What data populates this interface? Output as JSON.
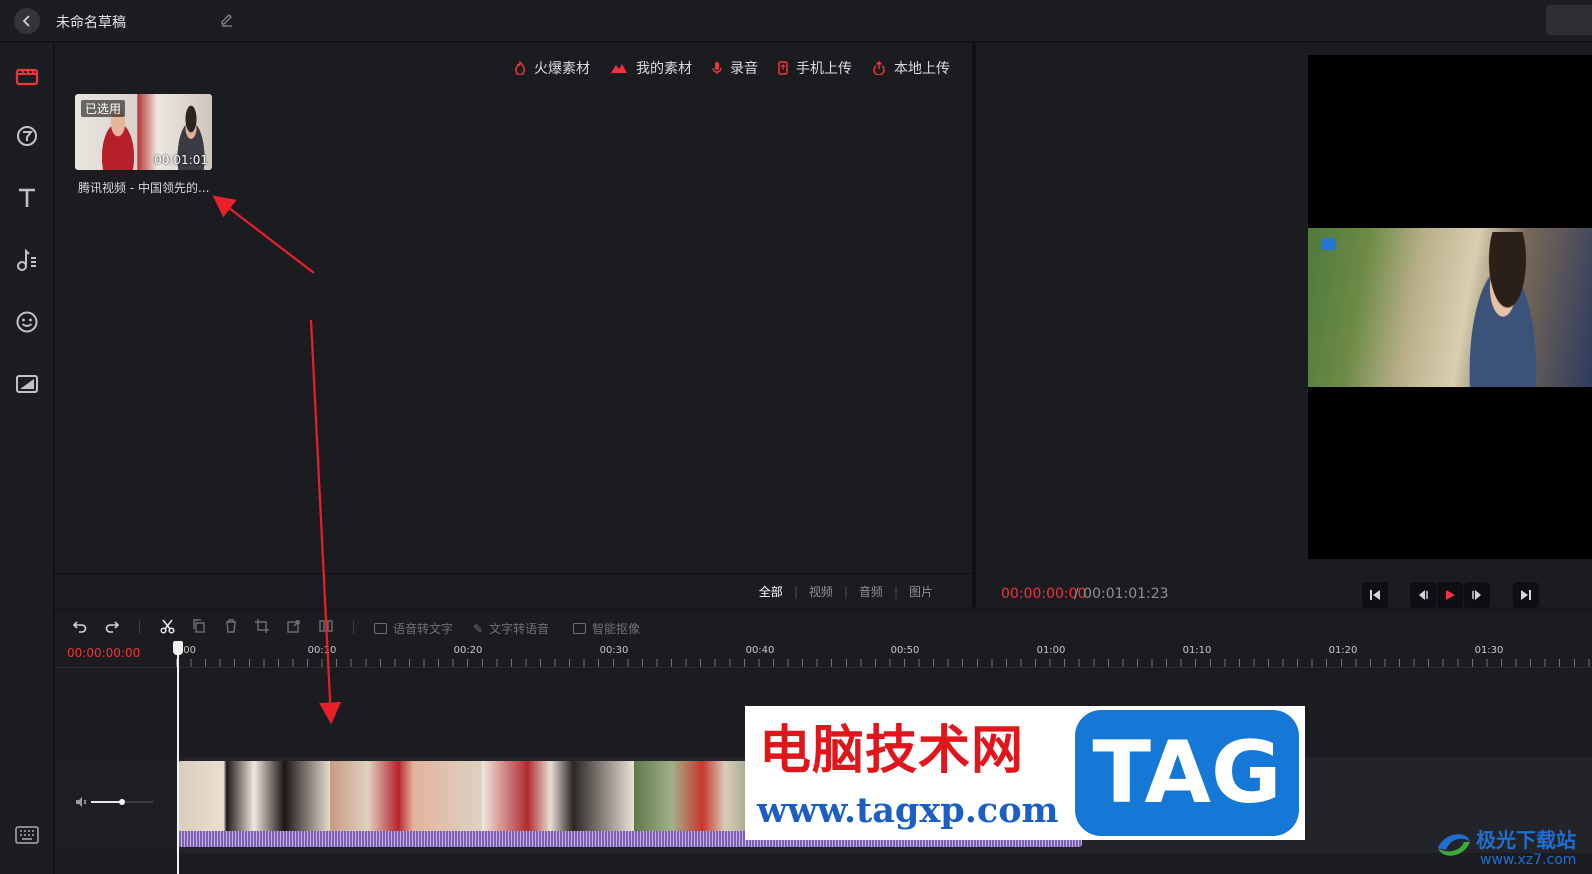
{
  "header": {
    "title": "未命名草稿",
    "back_icon": "chevron-left-icon",
    "edit_icon": "pencil-icon"
  },
  "sidebar": {
    "items": [
      {
        "icon": "film-icon",
        "active": true
      },
      {
        "icon": "filter-icon"
      },
      {
        "icon": "text-icon"
      },
      {
        "icon": "music-icon"
      },
      {
        "icon": "sticker-icon"
      },
      {
        "icon": "picture-icon"
      }
    ],
    "bottom_icon": "keyboard-icon"
  },
  "media": {
    "source_tabs": [
      {
        "label": "火爆素材",
        "icon": "flame-icon"
      },
      {
        "label": "我的素材",
        "icon": "mountain-icon"
      },
      {
        "label": "录音",
        "icon": "mic-icon"
      },
      {
        "label": "手机上传",
        "icon": "phone-icon"
      },
      {
        "label": "本地上传",
        "icon": "upload-icon"
      }
    ],
    "item": {
      "badge": "已选用",
      "duration": "00:01:01",
      "name": "腾讯视频 - 中国领先的..."
    },
    "filter_tabs": [
      "全部",
      "视频",
      "音频",
      "图片"
    ],
    "active_filter": "全部"
  },
  "preview": {
    "time_current": "00:00:00:00",
    "time_separator": "/",
    "time_total": "00:01:01:23"
  },
  "timeline": {
    "toolbar_features": [
      "语音转文字",
      "文字转语音",
      "智能抠像"
    ],
    "timecode": "00:00:00:00",
    "ruler_labels": [
      ":00",
      "00:10",
      "00:20",
      "00:30",
      "00:40",
      "00:50",
      "01:00",
      "01:10",
      "01:20",
      "01:30"
    ],
    "volume_level": 0.5
  },
  "watermark": {
    "title": "电脑技术网",
    "url": "www.tagxp.com",
    "tag": "TAG"
  },
  "site_logo": {
    "name": "极光下载站",
    "url": "www.xz7.com"
  },
  "colors": {
    "accent": "#f0333d",
    "background": "#1b1c20",
    "clip": "#7f64b3"
  }
}
